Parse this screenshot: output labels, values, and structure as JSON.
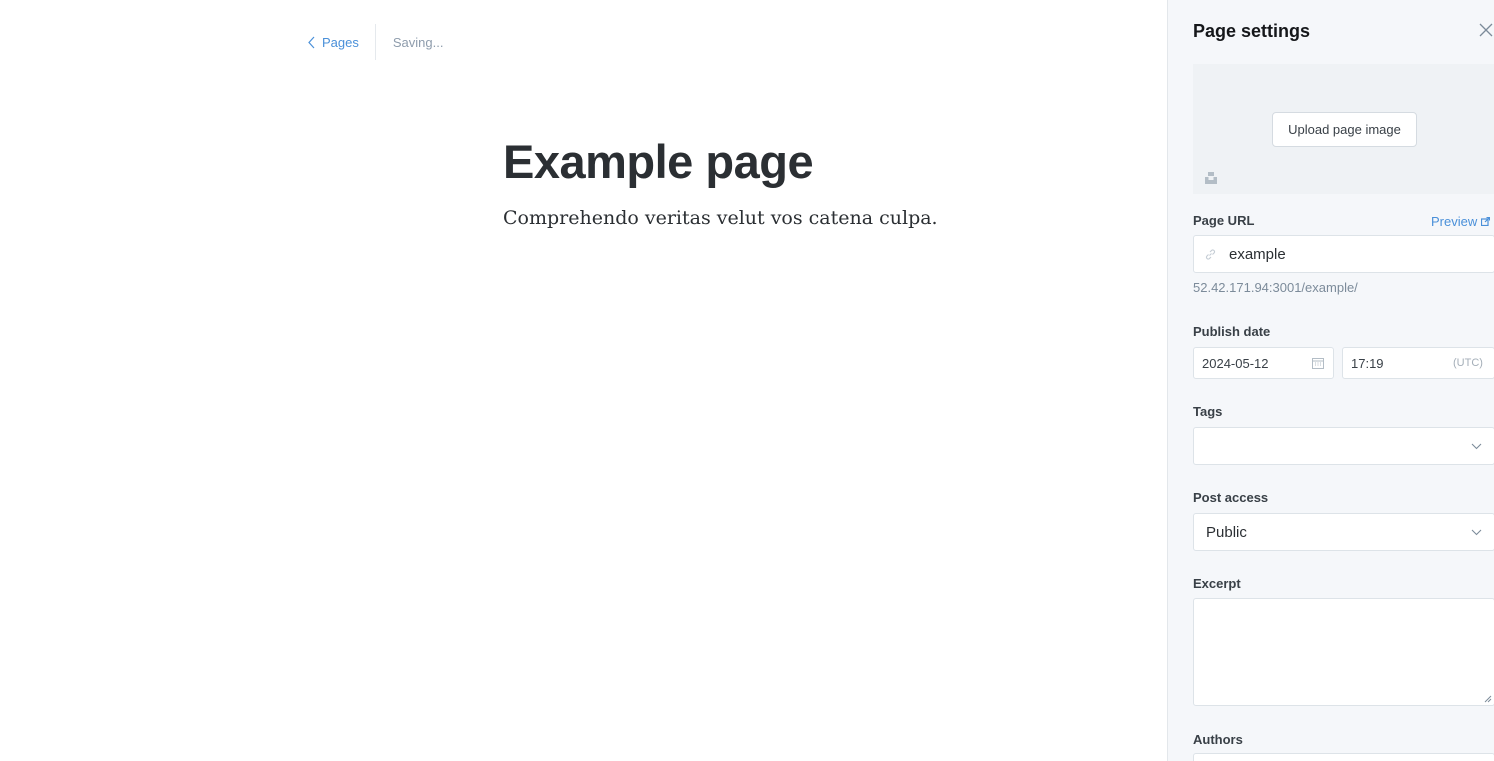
{
  "editor": {
    "back_label": "Pages",
    "status": "Saving...",
    "title": "Example page",
    "body": "Comprehendo veritas velut vos catena culpa."
  },
  "settings": {
    "title": "Page settings",
    "upload_label": "Upload page image",
    "page_url": {
      "label": "Page URL",
      "preview_label": "Preview",
      "value": "example",
      "full_url": "52.42.171.94:3001/example/"
    },
    "publish_date": {
      "label": "Publish date",
      "date": "2024-05-12",
      "time": "17:19",
      "timezone": "(UTC)"
    },
    "tags": {
      "label": "Tags",
      "value": ""
    },
    "post_access": {
      "label": "Post access",
      "value": "Public"
    },
    "excerpt": {
      "label": "Excerpt",
      "value": ""
    },
    "authors": {
      "label": "Authors"
    }
  },
  "colors": {
    "accent": "#4a90d9",
    "panel_bg": "#f5f7fa",
    "text": "#2b2f33",
    "muted": "#8e9cac"
  }
}
